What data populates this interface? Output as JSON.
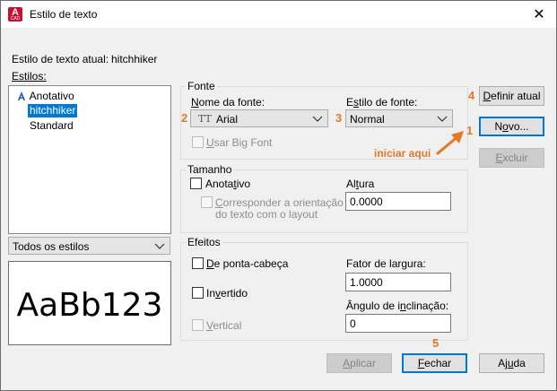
{
  "window": {
    "title": "Estilo de texto",
    "close_glyph": "✕"
  },
  "current_style": {
    "label": "Estilo de texto atual:",
    "value": "hitchhiker"
  },
  "styles": {
    "label": "Estilos:",
    "items": [
      {
        "label": "Anotativo",
        "icon": "annotative-icon",
        "selected": false
      },
      {
        "label": "hitchhiker",
        "selected": true
      },
      {
        "label": "Standard",
        "selected": false
      }
    ],
    "filter": {
      "value": "Todos os estilos"
    }
  },
  "preview": {
    "text": "AaBb123"
  },
  "font": {
    "group": "Fonte",
    "name_label": "Nome da fonte:",
    "name_value": "Arial",
    "name_icon_glyph": "TT",
    "style_label": "Estilo de fonte:",
    "style_value": "Normal",
    "big_font_label": "Usar Big Font"
  },
  "size": {
    "group": "Tamanho",
    "annotative_label": "Anotativo",
    "match_orientation_line1": "Corresponder a orientação",
    "match_orientation_line2": "do texto com o layout",
    "height_label": "Altura",
    "height_value": "0.0000"
  },
  "effects": {
    "group": "Efeitos",
    "upside_down": "De ponta-cabeça",
    "backwards": "Invertido",
    "vertical": "Vertical",
    "width_factor_label": "Fator de largura:",
    "width_factor_value": "1.0000",
    "oblique_label": "Ângulo de inclinação:",
    "oblique_value": "0"
  },
  "buttons": {
    "set_current": "Definir atual",
    "new": "Novo...",
    "delete": "Excluir",
    "apply": "Aplicar",
    "close": "Fechar",
    "help": "Ajuda"
  },
  "annotations": {
    "n1": "1",
    "n2": "2",
    "n3": "3",
    "n4": "4",
    "n5": "5",
    "hint": "iniciar aqui",
    "color": "#e87722"
  },
  "colors": {
    "accent": "#0078d7",
    "brand": "#c8102e"
  }
}
